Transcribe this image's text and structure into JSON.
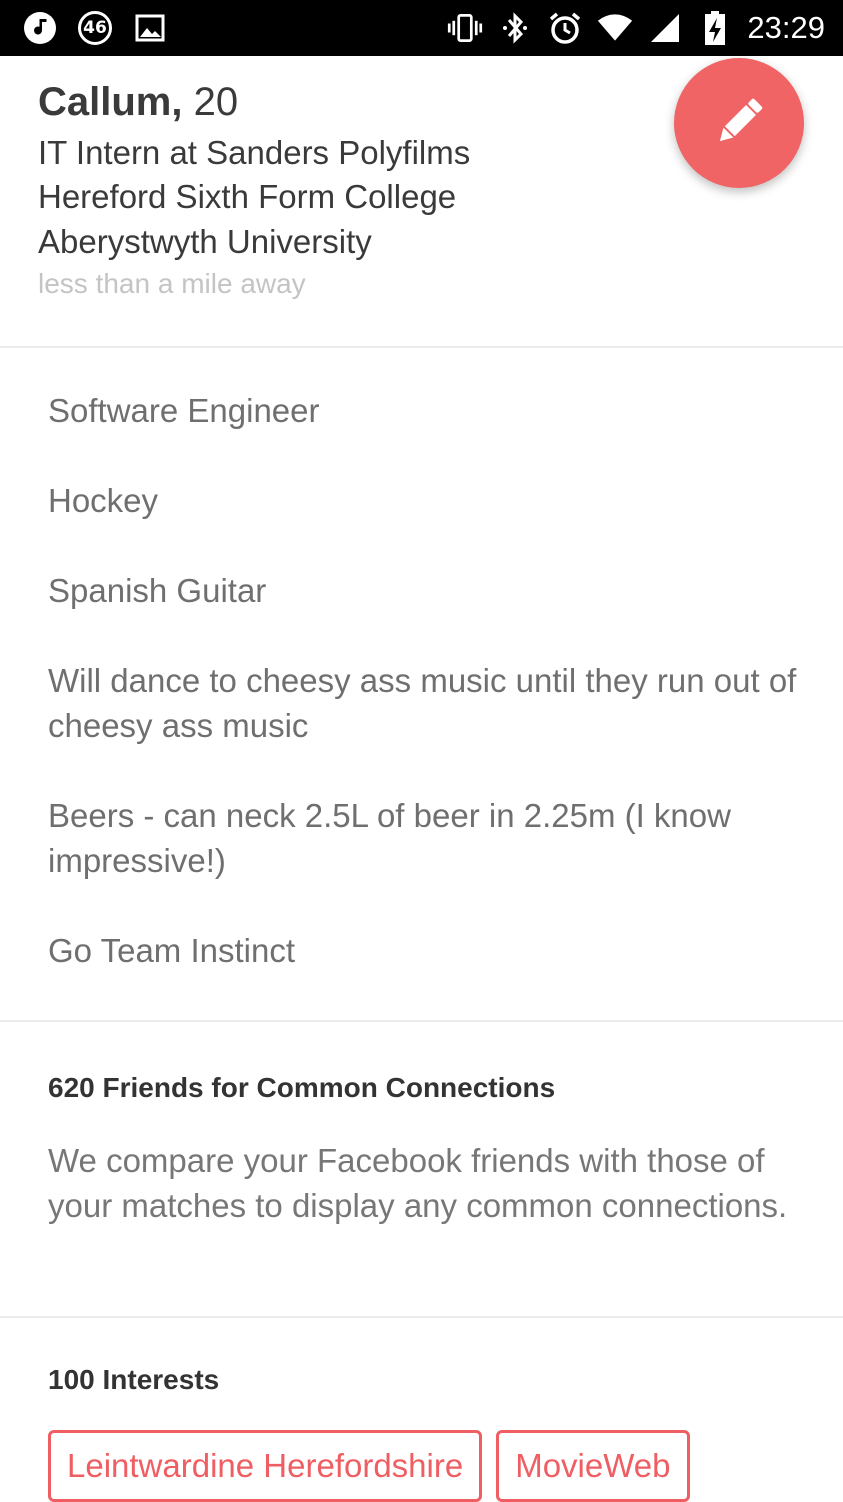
{
  "status_bar": {
    "notification_badge": "46",
    "time": "23:29"
  },
  "profile": {
    "name": "Callum,",
    "age": "20",
    "job": "IT Intern at Sanders Polyfilms",
    "school1": "Hereford Sixth Form College",
    "school2": "Aberystwyth University",
    "distance": "less than a mile away"
  },
  "bio": {
    "lines": [
      "Software Engineer",
      "Hockey",
      "Spanish Guitar",
      "Will dance to cheesy ass music until they run out of cheesy ass music",
      "Beers - can neck 2.5L of beer in 2.25m (I know impressive!)",
      "Go Team Instinct"
    ]
  },
  "connections": {
    "title": "620 Friends for Common Connections",
    "description": "We compare your Facebook friends with those of your matches to display any common connections."
  },
  "interests": {
    "title": "100 Interests",
    "items": [
      "Leintwardine Herefordshire",
      "MovieWeb"
    ]
  },
  "colors": {
    "accent": "#f06466",
    "chip": "#ee5e62"
  },
  "icons": {
    "edit": "pencil-icon"
  }
}
